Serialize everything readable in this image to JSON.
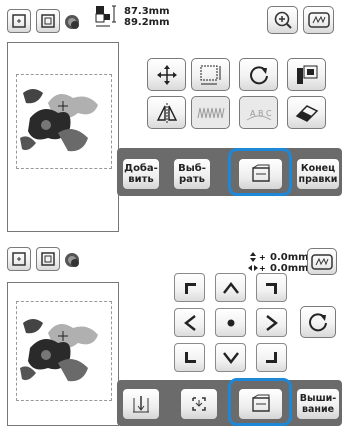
{
  "screen1": {
    "size_width": "87.3mm",
    "size_height": "89.2mm",
    "buttons": {
      "add": "Доба-\nвить",
      "select": "Выб-\nрать",
      "end_edit": "Конец\nправки"
    }
  },
  "screen2": {
    "offset_v": "0.0mm",
    "offset_h": "0.0mm",
    "buttons": {
      "embroider": "Выши-\nвание"
    }
  },
  "colors": {
    "highlight": "#1e88d6",
    "toolbar": "#6b6b6b"
  }
}
